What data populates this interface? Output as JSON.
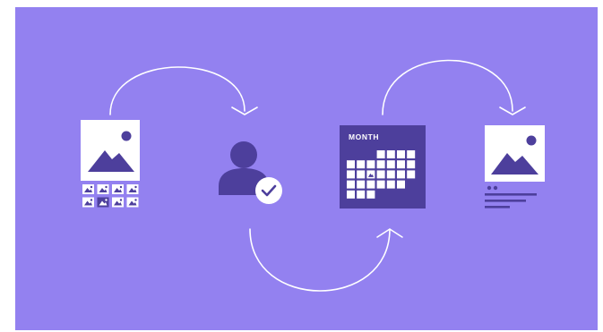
{
  "colors": {
    "background": "#9381f0",
    "ink": "#4d3f9c",
    "paper": "#ffffff",
    "highlight": "#7a6ad8"
  },
  "calendar": {
    "label": "MONTH"
  },
  "icons": [
    "image-gallery-icon",
    "user-check-icon",
    "calendar-month-icon",
    "image-post-icon",
    "arrow-icon"
  ]
}
